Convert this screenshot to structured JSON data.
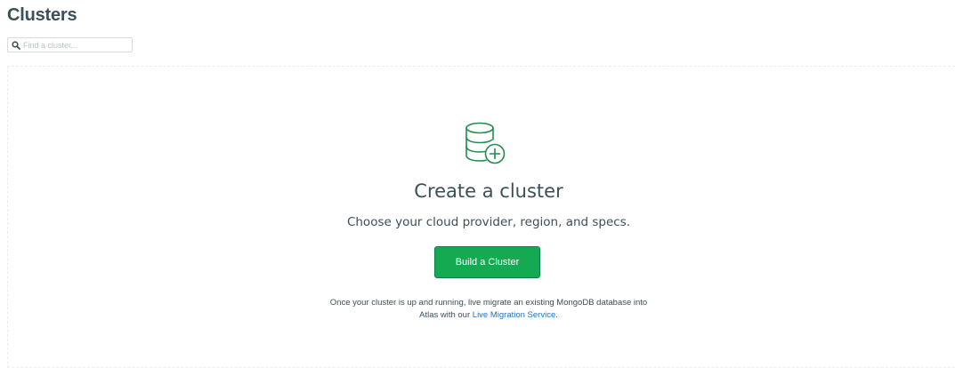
{
  "header": {
    "title": "Clusters"
  },
  "search": {
    "placeholder": "Find a cluster...",
    "value": ""
  },
  "empty_state": {
    "icon": "database-plus-icon",
    "title": "Create a cluster",
    "subtitle": "Choose your cloud provider, region, and specs.",
    "button_label": "Build a Cluster",
    "note_line1": "Once your cluster is up and running, live migrate an existing MongoDB database into",
    "note_line2_prefix": "Atlas with our ",
    "note_link": "Live Migration Service",
    "note_line2_suffix": "."
  },
  "colors": {
    "accent_green": "#13aa52",
    "icon_green": "#1f8d4e",
    "link_blue": "#1a73c9",
    "text": "#3d4f58"
  }
}
